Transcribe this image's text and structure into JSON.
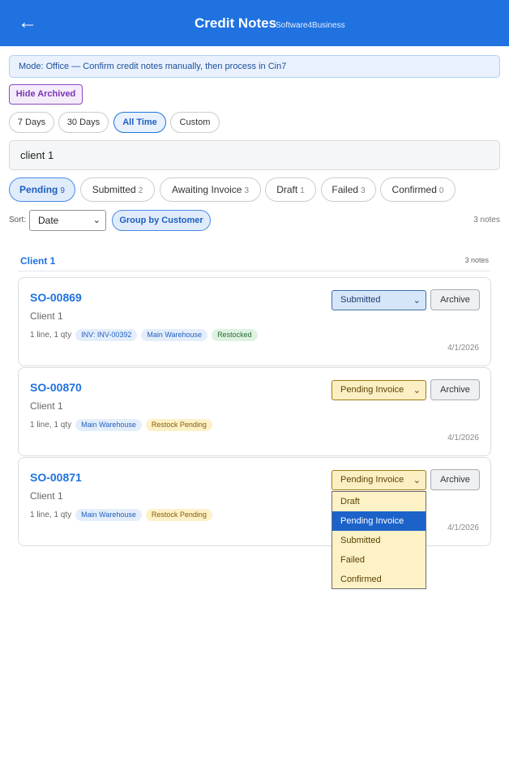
{
  "header": {
    "back_icon": "arrow-left-icon",
    "back_glyph": "←",
    "title": "Credit Notes",
    "subtitle": "Software4Business"
  },
  "banner": {
    "text": "Mode: Office — Confirm credit notes manually, then process in Cin7"
  },
  "hide_archived": "Hide Archived",
  "ranges": [
    {
      "label": "7 Days"
    },
    {
      "label": "30 Days"
    },
    {
      "label": "All Time"
    },
    {
      "label": "Custom"
    }
  ],
  "search": {
    "value": "client 1"
  },
  "filters": [
    {
      "label": "Pending",
      "count": "9"
    },
    {
      "label": "Submitted",
      "count": "2"
    },
    {
      "label": "Awaiting Invoice",
      "count": "3"
    },
    {
      "label": "Draft",
      "count": "1"
    },
    {
      "label": "Failed",
      "count": "3"
    },
    {
      "label": "Confirmed",
      "count": "0"
    }
  ],
  "sort": {
    "label": "Sort:",
    "value": "Date",
    "chevron": "⌄"
  },
  "group_btn": "Group by Customer",
  "notes_count": "3 notes",
  "group": {
    "name": "Client 1",
    "count": "3 notes"
  },
  "cards": [
    {
      "so": "SO-00869",
      "customer": "Client 1",
      "lines": "1 line, 1 qty",
      "tags": [
        "INV: INV-00392",
        "Main Warehouse",
        "Restocked"
      ],
      "status": "Submitted",
      "archive": "Archive",
      "date": "4/1/2026"
    },
    {
      "so": "SO-00870",
      "customer": "Client 1",
      "lines": "1 line, 1 qty",
      "tags": [
        "Main Warehouse",
        "Restock Pending"
      ],
      "status": "Pending Invoice",
      "archive": "Archive",
      "date": "4/1/2026"
    },
    {
      "so": "SO-00871",
      "customer": "Client 1",
      "lines": "1 line, 1 qty",
      "tags": [
        "Main Warehouse",
        "Restock Pending"
      ],
      "status": "Pending Invoice",
      "archive": "Archive",
      "date": "4/1/2026"
    }
  ],
  "dropdown": {
    "options": [
      "Draft",
      "Pending Invoice",
      "Submitted",
      "Failed",
      "Confirmed"
    ],
    "selected": "Pending Invoice"
  },
  "colors": {
    "header": "#1f72e0",
    "accent": "#1f72e0",
    "purple": "#7a36b4"
  }
}
